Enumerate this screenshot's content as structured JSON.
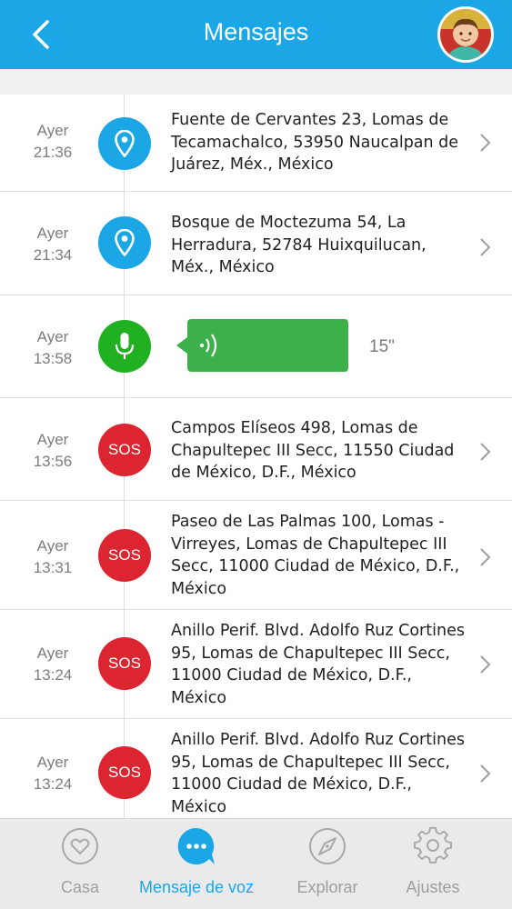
{
  "header": {
    "title": "Mensajes",
    "avatar": "child-avatar"
  },
  "messages": [
    {
      "day": "Ayer",
      "time": "21:36",
      "type": "location",
      "icon": "location-pin-icon",
      "text": "Fuente de Cervantes 23, Lomas de Tecamachalco, 53950 Naucalpan de Juárez, Méx., México"
    },
    {
      "day": "Ayer",
      "time": "21:34",
      "type": "location",
      "icon": "location-pin-icon",
      "text": "Bosque de Moctezuma 54, La Herradura, 52784 Huixquilucan, Méx., México"
    },
    {
      "day": "Ayer",
      "time": "13:58",
      "type": "voice",
      "icon": "microphone-icon",
      "duration": "15\""
    },
    {
      "day": "Ayer",
      "time": "13:56",
      "type": "sos",
      "sos_label": "SOS",
      "text": "Campos Elíseos 498, Lomas de Chapultepec III Secc, 11550 Ciudad de México, D.F., México"
    },
    {
      "day": "Ayer",
      "time": "13:31",
      "type": "sos",
      "sos_label": "SOS",
      "text": "Paseo de Las Palmas 100, Lomas - Virreyes, Lomas de Chapultepec III Secc, 11000 Ciudad de México, D.F., México"
    },
    {
      "day": "Ayer",
      "time": "13:24",
      "type": "sos",
      "sos_label": "SOS",
      "text": "Anillo Perif. Blvd. Adolfo Ruz Cortines 95, Lomas de Chapultepec III Secc, 11000 Ciudad de México, D.F., México"
    },
    {
      "day": "Ayer",
      "time": "13:24",
      "type": "sos",
      "sos_label": "SOS",
      "text": "Anillo Perif. Blvd. Adolfo Ruz Cortines 95, Lomas de Chapultepec III Secc, 11000 Ciudad de México, D.F., México"
    }
  ],
  "tabs": [
    {
      "label": "Casa",
      "icon": "heart-icon",
      "active": false
    },
    {
      "label": "Mensaje de voz",
      "icon": "chat-bubble-icon",
      "active": true
    },
    {
      "label": "Explorar",
      "icon": "compass-icon",
      "active": false
    },
    {
      "label": "Ajustes",
      "icon": "gear-icon",
      "active": false
    }
  ],
  "colors": {
    "accent": "#1ba7e6",
    "sos": "#dc2530",
    "voice": "#22b023"
  }
}
